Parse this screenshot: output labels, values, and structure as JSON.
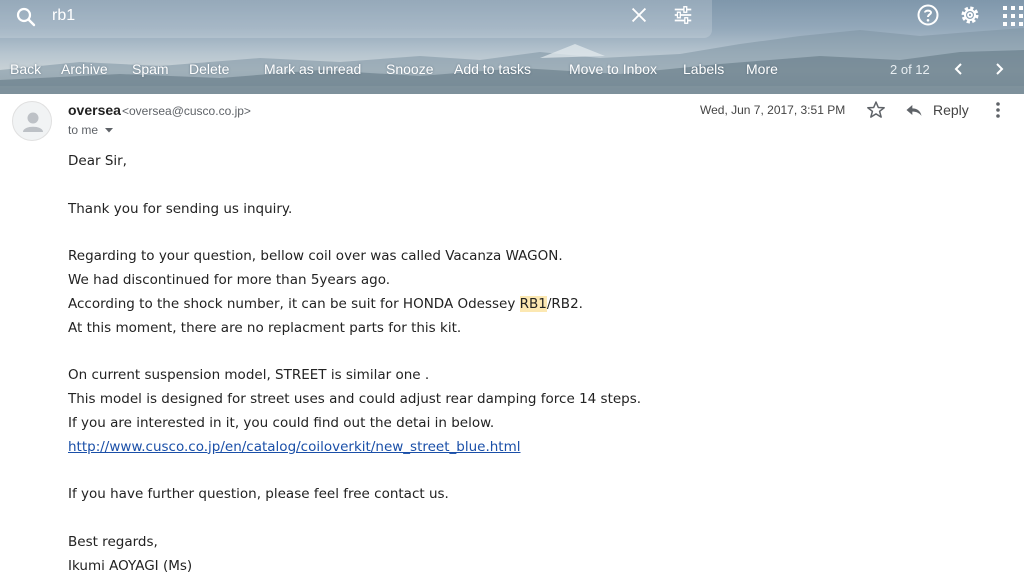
{
  "search": {
    "query": "rb1"
  },
  "toolbar": {
    "back": "Back",
    "archive": "Archive",
    "spam": "Spam",
    "delete": "Delete",
    "mark_unread": "Mark as unread",
    "snooze": "Snooze",
    "add_tasks": "Add to tasks",
    "move_inbox": "Move to Inbox",
    "labels": "Labels",
    "more": "More",
    "pager": "2 of 12"
  },
  "message": {
    "sender_name": "oversea",
    "sender_email": "<oversea@cusco.co.jp>",
    "to": "to me",
    "date": "Wed, Jun 7, 2017, 3:51 PM",
    "reply_label": "Reply",
    "body": {
      "greeting": "Dear Sir,",
      "l1": "Thank you for sending us inquiry.",
      "l2": "Regarding to your question, bellow coil over was called Vacanza WAGON.",
      "l3": "We had discontinued for more than  5years ago.",
      "l4_pre": "According to the shock number, it can be suit for HONDA Odessey ",
      "l4_hl": "RB1",
      "l4_post": "/RB2.",
      "l5": "At this moment, there are no replacment parts for this kit.",
      "l6": "On current suspension model, STREET is similar one .",
      "l7": "This model is designed for street uses and could adjust rear damping force 14 steps.",
      "l8": "If you are interested in it, you could find out the detai in below.",
      "link": "http://www.cusco.co.jp/en/catalog/coiloverkit/new_street_blue.html",
      "l9": "If you have further question, please feel free contact us.",
      "closing": "Best regards,",
      "signature": "Ikumi AOYAGI (Ms)"
    }
  },
  "colors": {
    "highlight": "#fce8b2",
    "link": "#1a4fa8",
    "header_sky": "#93a8ba"
  },
  "icons": [
    "search-icon",
    "clear-icon",
    "filter-icon",
    "help-icon",
    "settings-icon",
    "apps-icon",
    "chevron-left-icon",
    "chevron-right-icon",
    "avatar-icon",
    "star-icon",
    "reply-icon",
    "more-vert-icon"
  ]
}
